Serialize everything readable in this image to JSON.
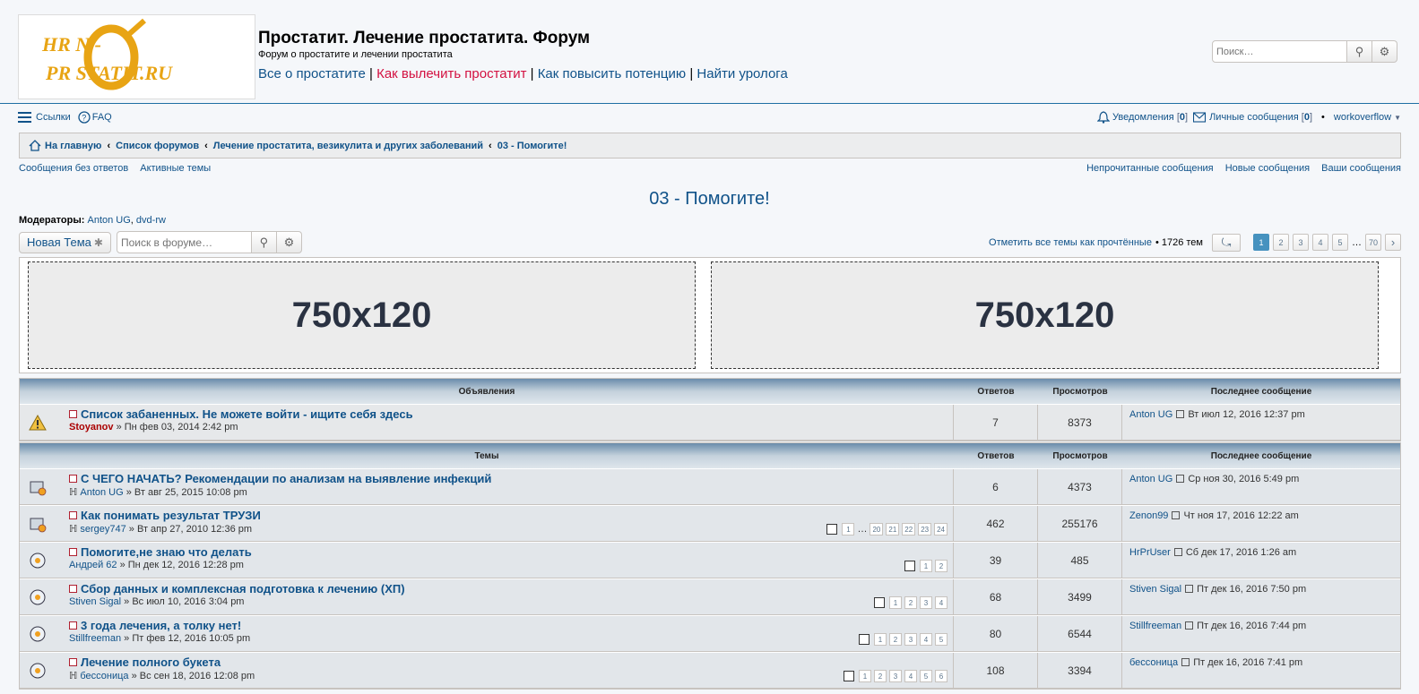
{
  "header": {
    "logo_text_line1": "HR   N -",
    "logo_text_line2": "PR    STATIT.RU",
    "title": "Простатит. Лечение простатита. Форум",
    "description": "Форум о простатите и лечении простатита",
    "links": [
      "Все о простатите",
      "Как вылечить простатит",
      "Как повысить потенцию",
      "Найти уролога"
    ],
    "link_sep": "|",
    "search_placeholder": "Поиск…"
  },
  "nav": {
    "links_label": "Ссылки",
    "faq_label": "FAQ",
    "notifications_label": "Уведомления",
    "notifications_count": "0",
    "pm_label": "Личные сообщения",
    "pm_count": "0",
    "bullet": "•",
    "username": "workoverflow"
  },
  "breadcrumbs": [
    "На главную",
    "Список форумов",
    "Лечение простатита, везикулита и других заболеваний",
    "03 - Помогите!"
  ],
  "breadcrumb_sep": "‹",
  "quicklinks": {
    "left": [
      "Сообщения без ответов",
      "Активные темы"
    ],
    "right": [
      "Непрочитанные сообщения",
      "Новые сообщения",
      "Ваши сообщения"
    ]
  },
  "forum": {
    "title": "03 - Помогите!",
    "moderators_label": "Модераторы:",
    "moderators": [
      "Anton UG",
      "dvd-rw"
    ],
    "new_topic_label": "Новая Тема",
    "search_placeholder": "Поиск в форуме…",
    "mark_read_label": "Отметить все темы как прочтённые",
    "topic_count_text": "• 1726 тем",
    "pages": [
      "1",
      "2",
      "3",
      "4",
      "5"
    ],
    "last_page": "70",
    "ellipsis": "…",
    "next_symbol": "›"
  },
  "banners": [
    "750x120",
    "750x120"
  ],
  "announcements": {
    "header": "Объявления",
    "col_replies": "Ответов",
    "col_views": "Просмотров",
    "col_last": "Последнее сообщение",
    "rows": [
      {
        "title": "Список забаненных. Не можете войти - ищите себя здесь",
        "author": "Stoyanov",
        "date": "» Пн фев 03, 2014 2:42 pm",
        "replies": "7",
        "views": "8373",
        "last_author": "Anton UG",
        "last_date": "Вт июл 12, 2016 12:37 pm"
      }
    ]
  },
  "topics": {
    "header": "Темы",
    "col_replies": "Ответов",
    "col_views": "Просмотров",
    "col_last": "Последнее сообщение",
    "rows": [
      {
        "title": "С ЧЕГО НАЧАТЬ? Рекомендации по анализам на выявление инфекций",
        "author": "Anton UG",
        "date": "» Вт авг 25, 2015 10:08 pm",
        "replies": "6",
        "views": "4373",
        "last_author": "Anton UG",
        "last_date": "Ср ноя 30, 2016 5:49 pm",
        "pages": []
      },
      {
        "title": "Как понимать результат ТРУЗИ",
        "author": "sergey747",
        "date": "» Вт апр 27, 2010 12:36 pm",
        "replies": "462",
        "views": "255176",
        "last_author": "Zenon99",
        "last_date": "Чт ноя 17, 2016 12:22 am",
        "pages": [
          "1",
          "…",
          "20",
          "21",
          "22",
          "23",
          "24"
        ]
      },
      {
        "title": "Помогите,не знаю что делать",
        "author": "Андрей 62",
        "date": "» Пн дек 12, 2016 12:28 pm",
        "replies": "39",
        "views": "485",
        "last_author": "HrPrUser",
        "last_date": "Сб дек 17, 2016 1:26 am",
        "pages": [
          "1",
          "2"
        ]
      },
      {
        "title": "Сбор данных и комплексная подготовка к лечению (ХП)",
        "author": "Stiven Sigal",
        "date": "» Вс июл 10, 2016 3:04 pm",
        "replies": "68",
        "views": "3499",
        "last_author": "Stiven Sigal",
        "last_date": "Пт дек 16, 2016 7:50 pm",
        "pages": [
          "1",
          "2",
          "3",
          "4"
        ]
      },
      {
        "title": "3 года лечения, а толку нет!",
        "author": "Stillfreeman",
        "date": "» Пт фев 12, 2016 10:05 pm",
        "replies": "80",
        "views": "6544",
        "last_author": "Stillfreeman",
        "last_date": "Пт дек 16, 2016 7:44 pm",
        "pages": [
          "1",
          "2",
          "3",
          "4",
          "5"
        ]
      },
      {
        "title": "Лечение полного букета",
        "author": "бессоница",
        "date": "» Вс сен 18, 2016 12:08 pm",
        "replies": "108",
        "views": "3394",
        "last_author": "бессоница",
        "last_date": "Пт дек 16, 2016 7:41 pm",
        "pages": [
          "1",
          "2",
          "3",
          "4",
          "5",
          "6"
        ]
      }
    ]
  },
  "colors": {
    "link": "#105289",
    "accent_red": "#d31141",
    "page_active": "#4692bf"
  }
}
